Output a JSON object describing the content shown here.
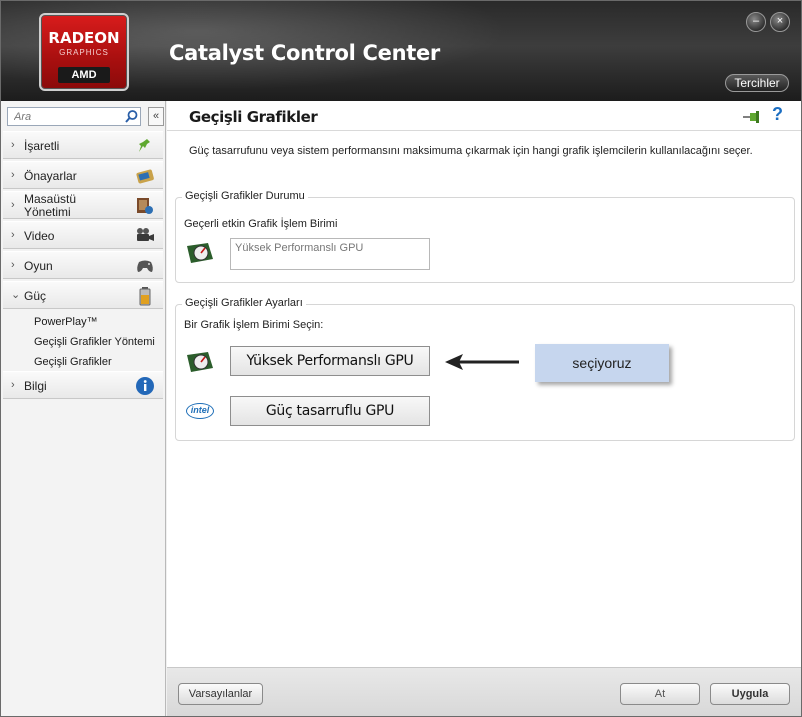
{
  "header": {
    "logo_brand": "RADEON",
    "logo_sub": "GRAPHICS",
    "logo_maker": "AMD",
    "app_title": "Catalyst Control Center",
    "preferences_label": "Tercihler",
    "minimize_glyph": "–",
    "close_glyph": "×"
  },
  "sidebar": {
    "search_placeholder": "Ara",
    "collapse_glyph": "«",
    "items": [
      {
        "label": "İşaretli",
        "icon": "pin-icon"
      },
      {
        "label": "Önayarlar",
        "icon": "presets-icon"
      },
      {
        "label": "Masaüstü",
        "label2": "Yönetimi",
        "icon": "desktop-management-icon"
      },
      {
        "label": "Video",
        "icon": "video-camera-icon"
      },
      {
        "label": "Oyun",
        "icon": "gamepad-icon"
      },
      {
        "label": "Güç",
        "icon": "battery-icon",
        "expanded": true
      },
      {
        "label": "Bilgi",
        "icon": "info-icon"
      }
    ],
    "power_subitems": [
      "PowerPlay™",
      "Geçişli Grafikler Yöntemi",
      "Geçişli Grafikler"
    ]
  },
  "main": {
    "page_title": "Geçişli Grafikler",
    "description": "Güç tasarrufunu veya sistem performansını maksimuma çıkarmak için hangi grafik işlemcilerin kullanılacağını seçer.",
    "status_group": {
      "title": "Geçişli Grafikler Durumu",
      "current_label": "Geçerli etkin Grafik İşlem Birimi",
      "current_value": "Yüksek Performanslı GPU"
    },
    "settings_group": {
      "title": "Geçişli Grafikler Ayarları",
      "select_label": "Bir Grafik İşlem Birimi Seçin:",
      "high_perf_button": "Yüksek Performanslı GPU",
      "power_saving_button": "Güç tasarruflu GPU",
      "intel_logo": "intel"
    },
    "annotation": "seçiyoruz",
    "footer": {
      "defaults_button": "Varsayılanlar",
      "discard_button": "At",
      "apply_button": "Uygula"
    }
  },
  "colors": {
    "radeon_red": "#c41414",
    "help_blue": "#1b6ec2",
    "callout_bg": "#c6d6ee"
  }
}
